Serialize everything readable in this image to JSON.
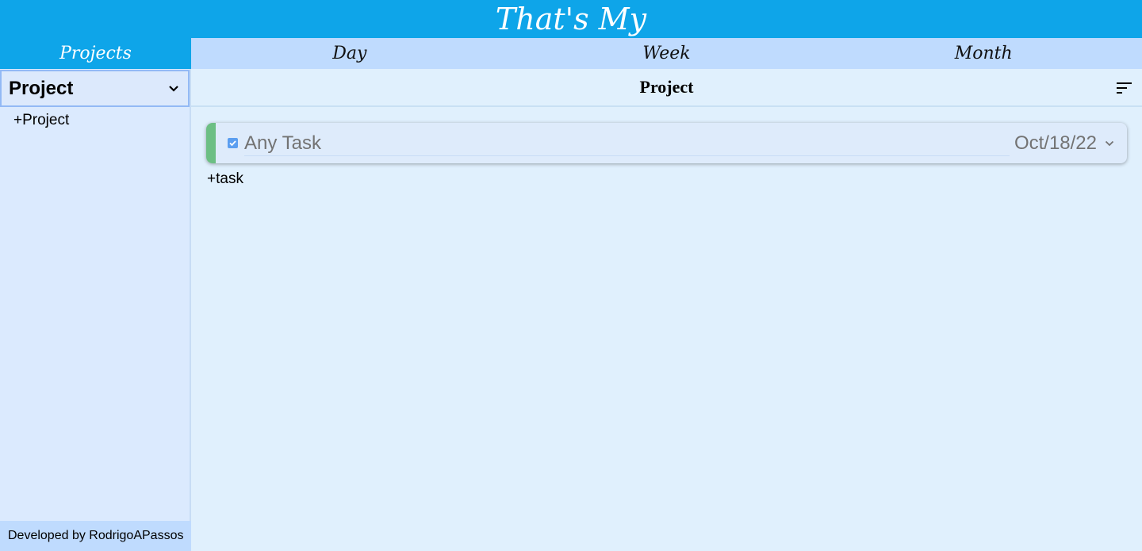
{
  "header": {
    "title": "That's My"
  },
  "nav": {
    "projects_label": "Projects",
    "tabs": [
      {
        "label": "Day"
      },
      {
        "label": "Week"
      },
      {
        "label": "Month"
      }
    ]
  },
  "sidebar": {
    "project_select": {
      "selected": "Project"
    },
    "add_project_label": "+Project",
    "footer_text": "Developed by RodrigoAPassos"
  },
  "main": {
    "title": "Project",
    "tasks": [
      {
        "name": "Any Task",
        "date": "Oct/18/22",
        "checked": true,
        "priority_color": "#6cbf84"
      }
    ],
    "add_task_label": "+task"
  },
  "icons": {
    "sort": "sort-icon",
    "chevron": "chevron-down-icon",
    "checkbox": "checkbox-checked-icon"
  },
  "colors": {
    "header_bg": "#0ea5e9",
    "nav_bg": "#bfdbfe",
    "sidebar_bg": "#dbeafe",
    "main_bg": "#e0f0fd",
    "priority_green": "#6cbf84"
  }
}
